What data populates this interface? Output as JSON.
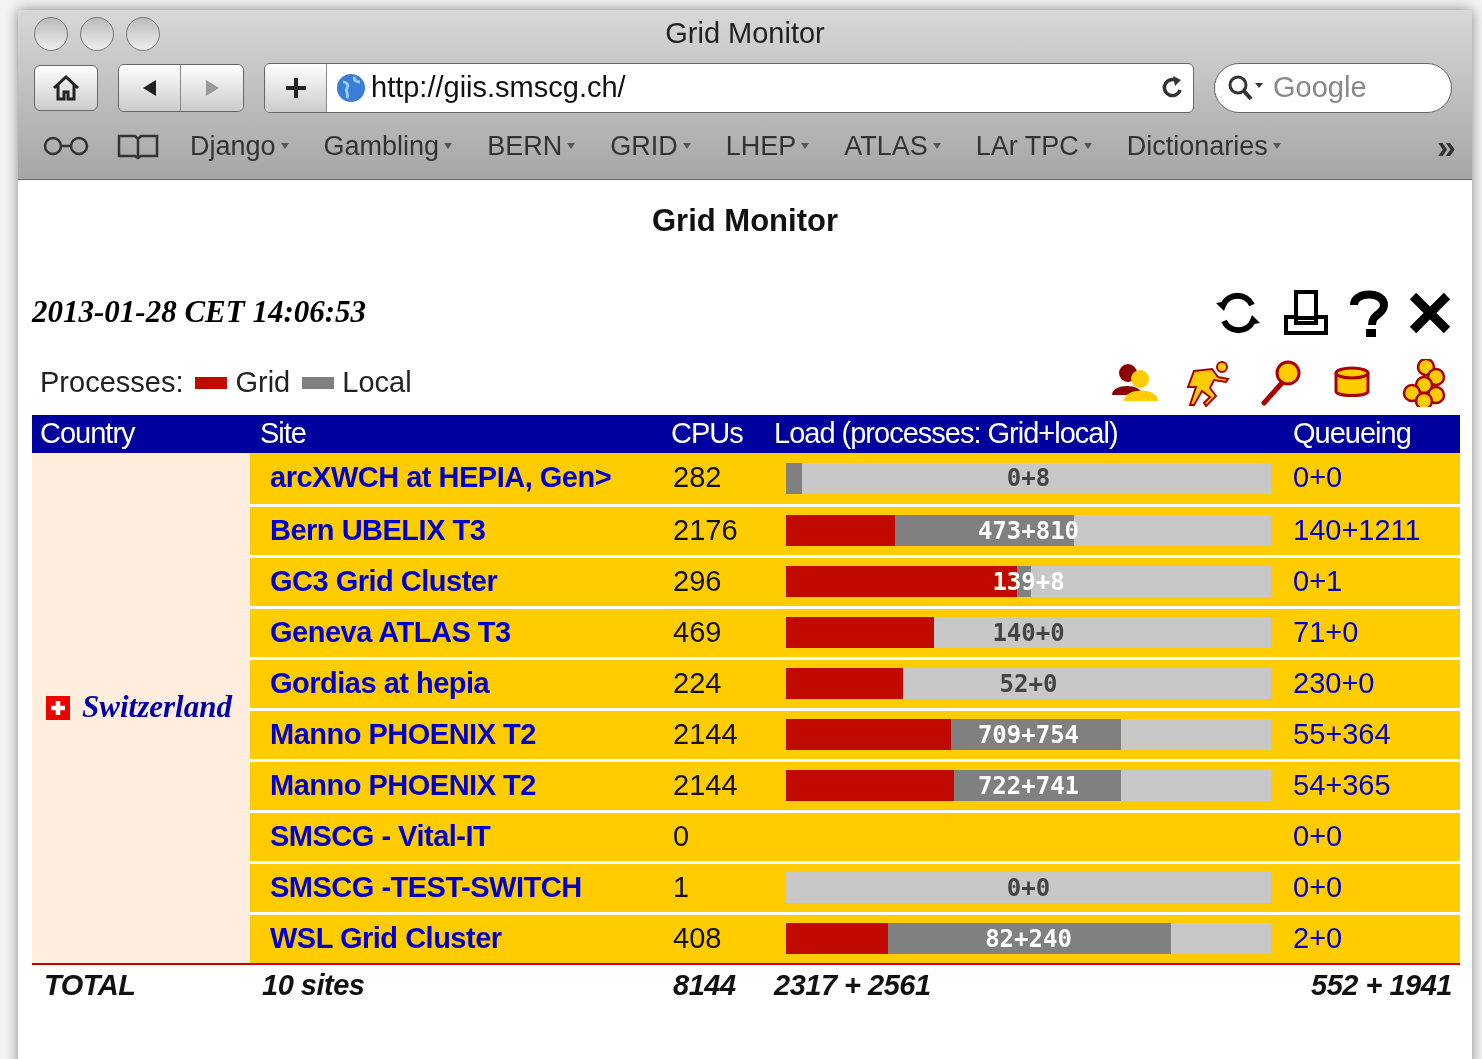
{
  "window": {
    "title": "Grid Monitor"
  },
  "address": {
    "url": "http://giis.smscg.ch/"
  },
  "search": {
    "placeholder": "Google"
  },
  "bookmarks": [
    "Django",
    "Gambling",
    "BERN",
    "GRID",
    "LHEP",
    "ATLAS",
    "LAr TPC",
    "Dictionaries"
  ],
  "overflow": "»",
  "page_title": "Grid Monitor",
  "timestamp": "2013-01-28 CET 14:06:53",
  "legend": {
    "label": "Processes:",
    "items": [
      {
        "name": "Grid",
        "color": "#c00a00"
      },
      {
        "name": "Local",
        "color": "#808080"
      }
    ]
  },
  "table": {
    "columns": [
      "Country",
      "Site",
      "CPUs",
      "Load (processes: Grid+local)",
      "Queueing"
    ],
    "country": "Switzerland",
    "rows": [
      {
        "site": "arcXWCH at HEPIA, Gen>",
        "cpus": "282",
        "load": {
          "total": {
            "level": 0.033
          },
          "reading": "0+8"
        },
        "queue": "0+0"
      },
      {
        "site": "Bern UBELIX T3",
        "cpus": "2176",
        "load": {
          "grid": {
            "level": 0.225
          },
          "total": {
            "level": 0.594
          },
          "reading": "473+810"
        },
        "queue": "140+1211"
      },
      {
        "site": "GC3 Grid Cluster",
        "cpus": "296",
        "load": {
          "grid": {
            "level": 0.476
          },
          "total": {
            "level": 0.505
          },
          "reading": "139+8"
        },
        "queue": "0+1"
      },
      {
        "site": "Geneva ATLAS T3",
        "cpus": "469",
        "load": {
          "grid": {
            "level": 0.305
          },
          "reading": "140+0"
        },
        "queue": "71+0"
      },
      {
        "site": "Gordias at hepia",
        "cpus": "224",
        "load": {
          "grid": {
            "level": 0.241
          },
          "reading": "52+0"
        },
        "queue": "230+0"
      },
      {
        "site": "Manno PHOENIX T2",
        "cpus": "2144",
        "load": {
          "grid": {
            "level": 0.34
          },
          "total": {
            "level": 0.69
          },
          "reading": "709+754"
        },
        "queue": "55+364"
      },
      {
        "site": "Manno PHOENIX T2",
        "cpus": "2144",
        "load": {
          "grid": {
            "level": 0.346
          },
          "total": {
            "level": 0.69
          },
          "reading": "722+741"
        },
        "queue": "54+365"
      },
      {
        "site": "SMSCG - Vital-IT",
        "cpus": "0",
        "queue": "0+0"
      },
      {
        "site": "SMSCG -TEST-SWITCH",
        "cpus": "1",
        "load": {
          "reading": "0+0"
        },
        "queue": "0+0"
      },
      {
        "site": "WSL Grid Cluster",
        "cpus": "408",
        "load": {
          "grid": {
            "level": 0.21
          },
          "total": {
            "level": 0.794
          },
          "reading": "82+240"
        },
        "queue": "2+0"
      }
    ],
    "total": {
      "label": "TOTAL",
      "sites": "10 sites",
      "cpus": "8144",
      "load": "2317 + 2561",
      "queue": "552 + 1941"
    }
  }
}
